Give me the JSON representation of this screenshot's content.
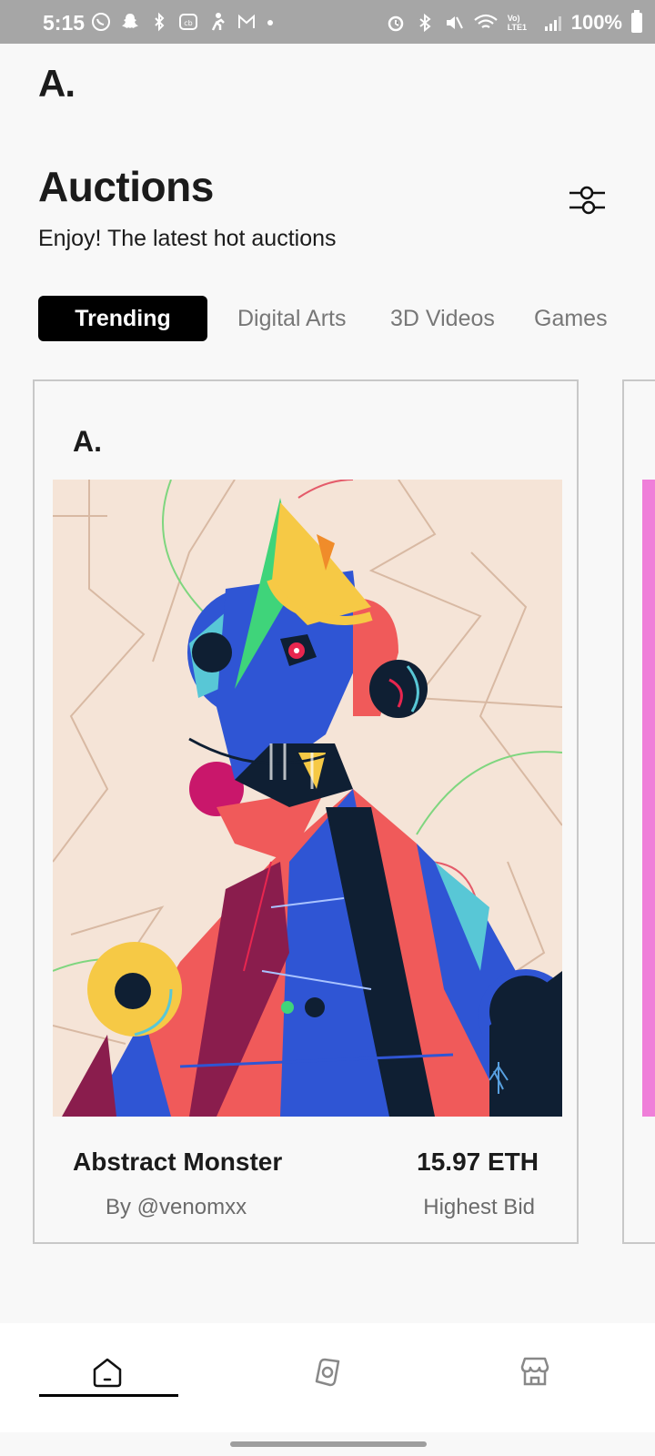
{
  "status_bar": {
    "time": "5:15",
    "battery": "100%",
    "network": "Vo) LTE1"
  },
  "header": {
    "logo": "A.",
    "title": "Auctions",
    "subtitle": "Enjoy! The latest hot auctions"
  },
  "tabs": [
    {
      "label": "Trending",
      "active": true
    },
    {
      "label": "Digital Arts",
      "active": false
    },
    {
      "label": "3D Videos",
      "active": false
    },
    {
      "label": "Games",
      "active": false
    }
  ],
  "cards": [
    {
      "logo": "A.",
      "name": "Abstract Monster",
      "creator": "By @venomxx",
      "price": "15.97 ETH",
      "price_label": "Highest Bid"
    }
  ],
  "bottom_nav": [
    {
      "icon": "home-icon",
      "active": true
    },
    {
      "icon": "explore-icon",
      "active": false
    },
    {
      "icon": "store-icon",
      "active": false
    }
  ],
  "colors": {
    "accent": "#000000",
    "background": "#f8f8f8",
    "muted_text": "#777777"
  }
}
